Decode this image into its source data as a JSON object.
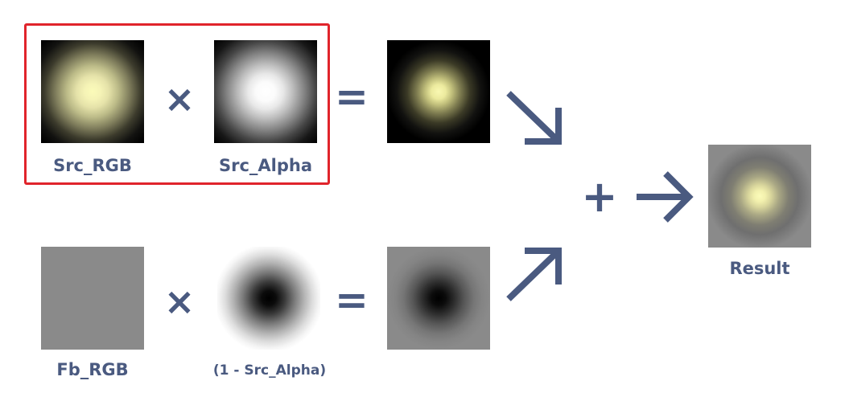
{
  "labels": {
    "src_rgb": "Src_RGB",
    "src_alpha": "Src_Alpha",
    "fb_rgb": "Fb_RGB",
    "inv_src_alpha": "(1 - Src_Alpha)",
    "result": "Result"
  },
  "operators": {
    "multiply": "×",
    "equals": "=",
    "add": "+"
  },
  "icons": {
    "top_arrow": "arrow-down-right-icon",
    "bottom_arrow": "arrow-up-right-icon",
    "result_arrow": "arrow-right-icon"
  },
  "colors": {
    "text": "#4a5a80",
    "highlight": "#e0242b",
    "framebuffer_gray": "#8a8a8a",
    "glow": "#fbfbb9"
  }
}
